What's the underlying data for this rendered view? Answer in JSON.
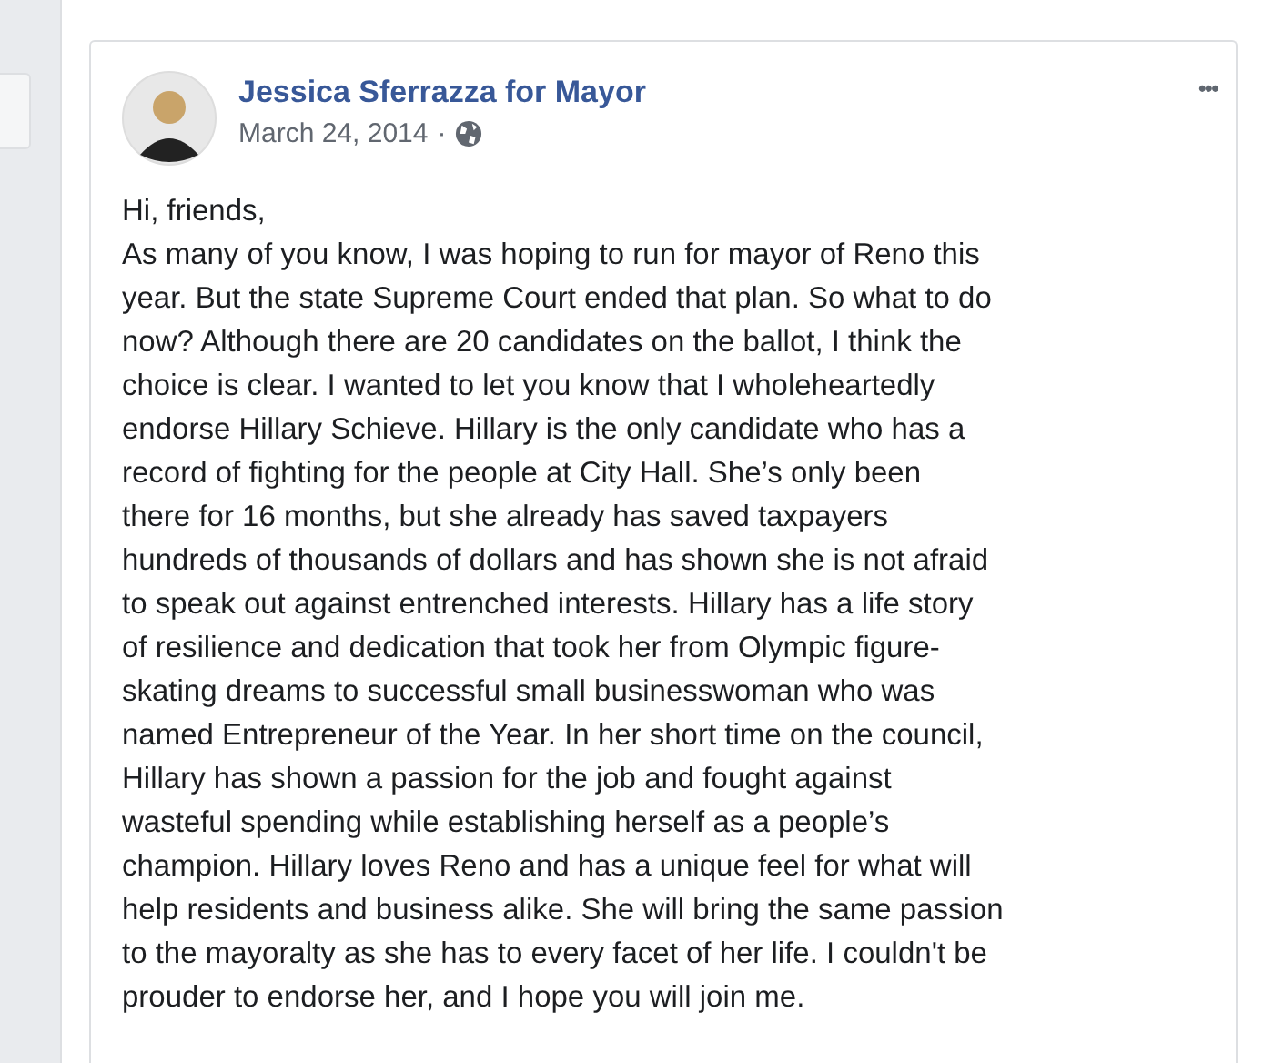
{
  "post": {
    "author": "Jessica Sferrazza for Mayor",
    "date": "March 24, 2014",
    "separator": "·",
    "menu": "•••",
    "lines": [
      "Hi, friends,",
      "As many of you know, I was hoping to run for mayor of Reno this",
      "year. But the state Supreme Court ended that plan. So what to do",
      "now? Although there are 20 candidates on the ballot, I think the",
      "choice is clear. I wanted to let you know that I wholeheartedly",
      "endorse Hillary Schieve. Hillary is the only candidate who has a",
      "record of fighting for the people at City Hall. She’s only been",
      "there for 16 months, but she already has saved taxpayers",
      "hundreds of thousands of dollars and has shown she is not afraid",
      "to speak out against entrenched interests. Hillary has a life story",
      "of resilience and dedication that took her from Olympic figure-",
      "skating dreams to successful small businesswoman who was",
      "named Entrepreneur of the Year. In her short time on the council,",
      "Hillary has shown a passion for the job and fought against",
      "wasteful spending while establishing herself as a people’s",
      "champion. Hillary loves Reno and has a unique feel for what will",
      "help residents and business alike. She will bring the same passion",
      "to the mayoralty as she has to every facet of her life. I couldn't be",
      "prouder to endorse her, and I hope you will join me."
    ]
  }
}
